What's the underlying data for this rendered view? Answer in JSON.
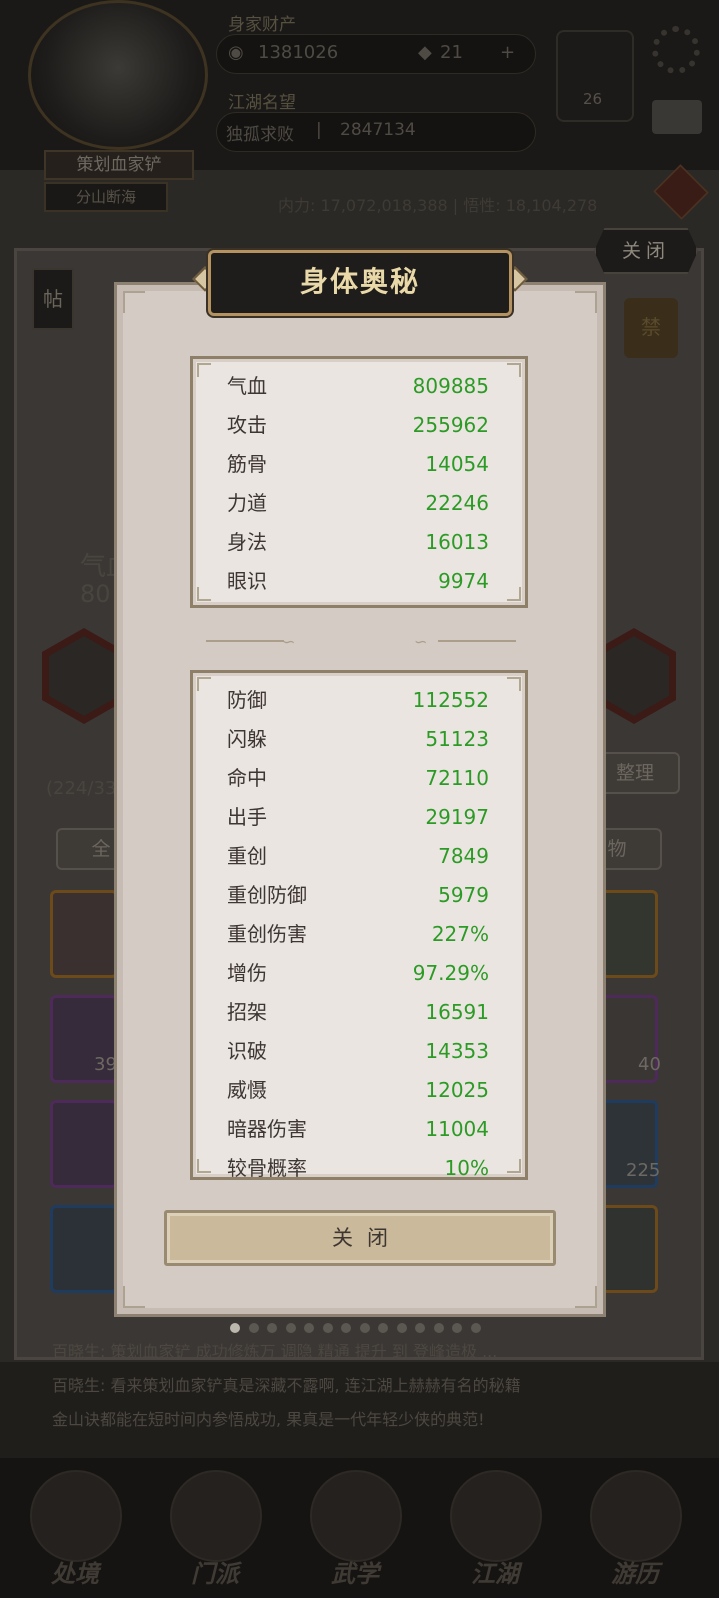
{
  "background": {
    "profile": {
      "name": "策划血家铲",
      "sub_title": "分山断海"
    },
    "assets": {
      "label": "身家财产",
      "gold": "1381026",
      "jade": "21",
      "add": "+"
    },
    "reputation": {
      "label": "江湖名望",
      "title": "独孤求败",
      "separator": "|",
      "value": "2847134"
    },
    "yin_yang_count": "26",
    "power_line": "内力: 17,072,018,388  |  悟性: 18,104,278",
    "close_top_label": "关闭",
    "tie_label": "帖",
    "ban_label": "禁",
    "left_stat_label": "气血",
    "left_stat_value": "80",
    "bag_count": "(224/33",
    "sort_label": "整理",
    "tab_all": "全",
    "tab_item": "物",
    "slot_counts": [
      "39",
      "40",
      "225"
    ],
    "log_lines": [
      "百晓生: 策划血家铲 成功修炼万 调隐 精通 提升 到 登峰造极 ...",
      "百晓生: 看来策划血家铲真是深藏不露啊, 连江湖上赫赫有名的秘籍",
      "金山诀都能在短时间内参悟成功, 果真是一代年轻少侠的典范!"
    ],
    "nav": [
      "处境",
      "门派",
      "武学",
      "江湖",
      "游历"
    ]
  },
  "modal": {
    "title": "身体奥秘",
    "primary_stats": [
      {
        "name": "气血",
        "value": "809885"
      },
      {
        "name": "攻击",
        "value": "255962"
      },
      {
        "name": "筋骨",
        "value": "14054"
      },
      {
        "name": "力道",
        "value": "22246"
      },
      {
        "name": "身法",
        "value": "16013"
      },
      {
        "name": "眼识",
        "value": "9974"
      }
    ],
    "secondary_stats": [
      {
        "name": "防御",
        "value": "112552"
      },
      {
        "name": "闪躲",
        "value": "51123"
      },
      {
        "name": "命中",
        "value": "72110"
      },
      {
        "name": "出手",
        "value": "29197"
      },
      {
        "name": "重创",
        "value": "7849"
      },
      {
        "name": "重创防御",
        "value": "5979"
      },
      {
        "name": "重创伤害",
        "value": "227%"
      },
      {
        "name": "增伤",
        "value": "97.29%"
      },
      {
        "name": "招架",
        "value": "16591"
      },
      {
        "name": "识破",
        "value": "14353"
      },
      {
        "name": "威慑",
        "value": "12025"
      },
      {
        "name": "暗器伤害",
        "value": "11004"
      },
      {
        "name": "较骨概率",
        "value": "10%"
      }
    ],
    "close_label": "关闭"
  },
  "page_dots": {
    "total": 14,
    "active": 0
  },
  "colors": {
    "stat_value": "#2c9b25",
    "title_text": "#e9d8a8",
    "modal_bg": "#d4cbc4"
  }
}
